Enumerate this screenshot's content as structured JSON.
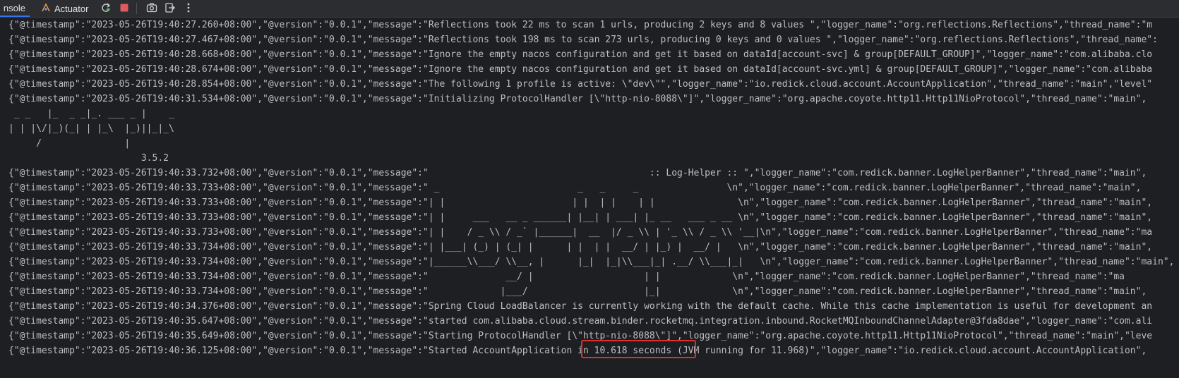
{
  "toolbar": {
    "console_tab": "nsole",
    "actuator_tab": "Actuator",
    "icons": [
      "actuator-icon",
      "rerun-icon",
      "stop-icon",
      "screenshot-icon",
      "exit-icon",
      "more-icon"
    ]
  },
  "colors": {
    "background": "#1e1f22",
    "toolbar": "#2b2d30",
    "text": "#bcbec4",
    "highlight_box": "#e0302a",
    "stop_button": "#db5c5c",
    "active_tab_underline": "#3574f0"
  },
  "console": {
    "lines": [
      "{\"@timestamp\":\"2023-05-26T19:40:27.260+08:00\",\"@version\":\"0.0.1\",\"message\":\"Reflections took 22 ms to scan 1 urls, producing 2 keys and 8 values \",\"logger_name\":\"org.reflections.Reflections\",\"thread_name\":\"m",
      "{\"@timestamp\":\"2023-05-26T19:40:27.467+08:00\",\"@version\":\"0.0.1\",\"message\":\"Reflections took 198 ms to scan 273 urls, producing 0 keys and 0 values \",\"logger_name\":\"org.reflections.Reflections\",\"thread_name\":",
      "{\"@timestamp\":\"2023-05-26T19:40:28.668+08:00\",\"@version\":\"0.0.1\",\"message\":\"Ignore the empty nacos configuration and get it based on dataId[account-svc] & group[DEFAULT_GROUP]\",\"logger_name\":\"com.alibaba.clo",
      "{\"@timestamp\":\"2023-05-26T19:40:28.674+08:00\",\"@version\":\"0.0.1\",\"message\":\"Ignore the empty nacos configuration and get it based on dataId[account-svc.yml] & group[DEFAULT_GROUP]\",\"logger_name\":\"com.alibaba",
      "{\"@timestamp\":\"2023-05-26T19:40:28.854+08:00\",\"@version\":\"0.0.1\",\"message\":\"The following 1 profile is active: \\\"dev\\\"\",\"logger_name\":\"io.redick.cloud.account.AccountApplication\",\"thread_name\":\"main\",\"level\"",
      "{\"@timestamp\":\"2023-05-26T19:40:31.534+08:00\",\"@version\":\"0.0.1\",\"message\":\"Initializing ProtocolHandler [\\\"http-nio-8088\\\"]\",\"logger_name\":\"org.apache.coyote.http11.Http11NioProtocol\",\"thread_name\":\"main\",",
      " _ _   |_  _ _|_. ___ _ |    _",
      "| | |\\/|_)(_| | |_\\  |_)||_|_\\",
      "     /               |",
      "                        3.5.2",
      "{\"@timestamp\":\"2023-05-26T19:40:33.732+08:00\",\"@version\":\"0.0.1\",\"message\":\"                                        :: Log-Helper :: \",\"logger_name\":\"com.redick.banner.LogHelperBanner\",\"thread_name\":\"main\",",
      "{\"@timestamp\":\"2023-05-26T19:40:33.733+08:00\",\"@version\":\"0.0.1\",\"message\":\" _                         _   _     _                \\n\",\"logger_name\":\"com.redick.banner.LogHelperBanner\",\"thread_name\":\"main\",",
      "{\"@timestamp\":\"2023-05-26T19:40:33.733+08:00\",\"@version\":\"0.0.1\",\"message\":\"| |                       | |  | |    | |               \\n\",\"logger_name\":\"com.redick.banner.LogHelperBanner\",\"thread_name\":\"main\",",
      "{\"@timestamp\":\"2023-05-26T19:40:33.733+08:00\",\"@version\":\"0.0.1\",\"message\":\"| |     ___   __ _ ______| |__| | ___| |_ __   ___ _ __ \\n\",\"logger_name\":\"com.redick.banner.LogHelperBanner\",\"thread_name\":\"main\",",
      "{\"@timestamp\":\"2023-05-26T19:40:33.733+08:00\",\"@version\":\"0.0.1\",\"message\":\"| |    / _ \\\\ / _` |______|  __  |/ _ \\\\ | '_ \\\\ / _ \\\\ '__|\\n\",\"logger_name\":\"com.redick.banner.LogHelperBanner\",\"thread_name\":\"ma",
      "{\"@timestamp\":\"2023-05-26T19:40:33.734+08:00\",\"@version\":\"0.0.1\",\"message\":\"| |___| (_) | (_| |      | |  | |  __/ | |_) |  __/ |   \\n\",\"logger_name\":\"com.redick.banner.LogHelperBanner\",\"thread_name\":\"main\",",
      "{\"@timestamp\":\"2023-05-26T19:40:33.734+08:00\",\"@version\":\"0.0.1\",\"message\":\"|______\\\\___/ \\\\__, |      |_|  |_|\\\\___|_| .__/ \\\\___|_|   \\n\",\"logger_name\":\"com.redick.banner.LogHelperBanner\",\"thread_name\":\"main\",",
      "{\"@timestamp\":\"2023-05-26T19:40:33.734+08:00\",\"@version\":\"0.0.1\",\"message\":\"              __/ |                    | |             \\n\",\"logger_name\":\"com.redick.banner.LogHelperBanner\",\"thread_name\":\"ma",
      "{\"@timestamp\":\"2023-05-26T19:40:33.734+08:00\",\"@version\":\"0.0.1\",\"message\":\"             |___/                     |_|             \\n\",\"logger_name\":\"com.redick.banner.LogHelperBanner\",\"thread_name\":\"main\",",
      "{\"@timestamp\":\"2023-05-26T19:40:34.376+08:00\",\"@version\":\"0.0.1\",\"message\":\"Spring Cloud LoadBalancer is currently working with the default cache. While this cache implementation is useful for development an",
      "{\"@timestamp\":\"2023-05-26T19:40:35.647+08:00\",\"@version\":\"0.0.1\",\"message\":\"started com.alibaba.cloud.stream.binder.rocketmq.integration.inbound.RocketMQInboundChannelAdapter@3fda8dae\",\"logger_name\":\"com.ali",
      "{\"@timestamp\":\"2023-05-26T19:40:35.649+08:00\",\"@version\":\"0.0.1\",\"message\":\"Starting ProtocolHandler [\\\"http-nio-8088\\\"]\",\"logger_name\":\"org.apache.coyote.http11.Http11NioProtocol\",\"thread_name\":\"main\",\"leve",
      "{\"@timestamp\":\"2023-05-26T19:40:36.125+08:00\",\"@version\":\"0.0.1\",\"message\":\"Started AccountApplication in 10.618 seconds (JVM running for 11.968)\",\"logger_name\":\"io.redick.cloud.account.AccountApplication\","
    ]
  }
}
